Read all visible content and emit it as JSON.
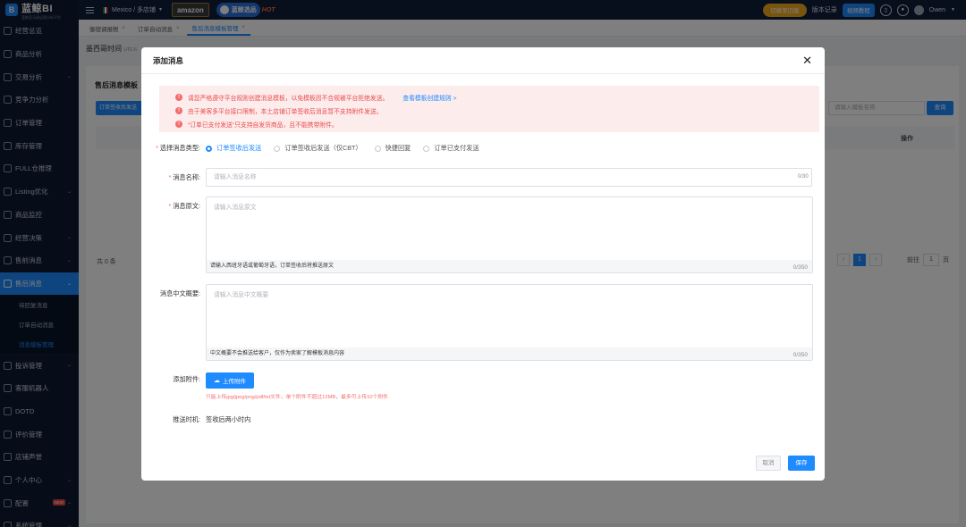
{
  "app": {
    "logo_text": "蓝鲸BI",
    "logo_sub": "蓝鲸亚马逊运营分析平台"
  },
  "sidebar": {
    "items": [
      {
        "label": "经营总览"
      },
      {
        "label": "商品分析"
      },
      {
        "label": "交易分析"
      },
      {
        "label": "竞争力分析"
      },
      {
        "label": "订单管理"
      },
      {
        "label": "库存管理"
      },
      {
        "label": "FULL仓推理"
      },
      {
        "label": "Listing优化"
      },
      {
        "label": "商品监控"
      },
      {
        "label": "经营决策"
      },
      {
        "label": "售前消息"
      },
      {
        "label": "售后消息"
      }
    ],
    "sub_items": [
      {
        "label": "待回复消息"
      },
      {
        "label": "订单自动消息"
      },
      {
        "label": "消息模板管理"
      }
    ],
    "items_after": [
      {
        "label": "投诉管理"
      },
      {
        "label": "客服机器人"
      },
      {
        "label": "DOTD"
      },
      {
        "label": "评价管理"
      },
      {
        "label": "店铺声誉"
      },
      {
        "label": "个人中心"
      },
      {
        "label": "配置"
      },
      {
        "label": "系统管理"
      }
    ],
    "new_badge": "NEW"
  },
  "topbar": {
    "store_label": "Mexico / 多店铺",
    "amazon_label": "amazon",
    "lanjing_label": "蓝鲸选品",
    "hot_label": "HOT",
    "switch_old_label": "切换至旧版",
    "version_label": "版本记录",
    "video_label": "视频教程",
    "user_name": "Owen"
  },
  "tabs": [
    {
      "label": "御宿调报税"
    },
    {
      "label": "订单自动消息"
    },
    {
      "label": "售后消息模板管理"
    }
  ],
  "background": {
    "timezone_label": "墨西哥时间",
    "timezone_sub": "UTC-6",
    "card_title": "售后消息模板",
    "create_button": "订单签收后发送",
    "search_placeholder": "请输入模板名称",
    "query_button": "查询",
    "operation_header": "操作",
    "total_label": "共 0 条",
    "page_current": "1",
    "goto_label": "前往",
    "goto_value": "1",
    "page_unit": "页"
  },
  "modal": {
    "title": "添加消息",
    "alerts": [
      {
        "text": "请您严格遵守平台规则创建消息模板，以免模板因不合规被平台拒绝发送。",
        "link": "查看模板创建规则 >"
      },
      {
        "text": "由于美客多平台接口限制，本土店铺订单签收后消息暂不支持附件发送。"
      },
      {
        "text": "“订单已支付发送”只支持自发货商品，且不能携带附件。"
      }
    ],
    "type_label": "选择消息类型:",
    "type_options": [
      {
        "label": "订单签收后发送",
        "checked": true
      },
      {
        "label": "订单签收后发送（仅CBT）",
        "checked": false
      },
      {
        "label": "快捷回复",
        "checked": false
      },
      {
        "label": "订单已支付发送",
        "checked": false
      }
    ],
    "name_label": "消息名称:",
    "name_placeholder": "请输入消息名称",
    "name_count": "0/30",
    "content_label": "消息原文:",
    "content_placeholder": "请输入消息原文",
    "content_hint": "请输入西班牙语或葡萄牙语，订单签收后将推送原文",
    "content_count": "0/350",
    "summary_label": "消息中文概要:",
    "summary_placeholder": "请输入消息中文概要",
    "summary_hint": "中文概要不会推送给客户，仅作为卖家了解模板消息内容",
    "summary_count": "0/350",
    "attach_label": "添加附件:",
    "upload_button": "上传附件",
    "upload_hint": "只能上传jpg/jpeg/png/pdf/txt文件，单个附件不超过12MB，最多可上传10个附件",
    "push_label": "推送时机:",
    "push_value": "签收后两小时内",
    "cancel_button": "取消",
    "save_button": "保存"
  }
}
